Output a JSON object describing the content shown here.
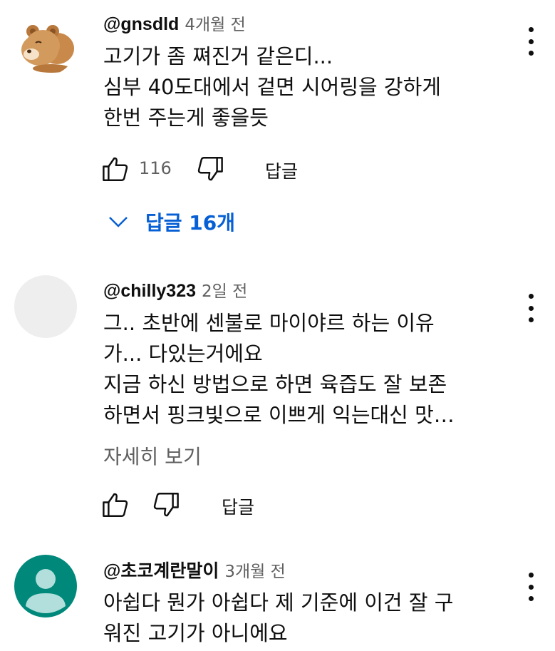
{
  "comments": [
    {
      "handle": "@gnsdld",
      "time": "4개월 전",
      "text_lines": [
        "고기가 좀 쪄진거 같은디...",
        "심부 40도대에서 겉면 시어링을 강하게",
        "한번 주는게 좋을듯"
      ],
      "like_count": "116",
      "reply_label": "답글",
      "replies_toggle": "답글 16개",
      "avatar": "bear-avatar"
    },
    {
      "handle": "@chilly323",
      "time": "2일 전",
      "text_lines": [
        "그.. 초반에 센불로 마이야르 하는 이유",
        "가... 다있는거에요",
        "지금 하신 방법으로 하면 육즙도 잘 보존",
        "하면서 핑크빛으로 이쁘게 익는대신 맛…"
      ],
      "read_more": "자세히 보기",
      "reply_label": "답글",
      "avatar": "blank-avatar"
    },
    {
      "handle": "@초코계란말이",
      "time": "3개월 전",
      "text_lines": [
        "아쉽다 뭔가 아쉽다 제 기준에 이건 잘 구",
        "워진 고기가 아니에요"
      ],
      "avatar": "default-person-avatar"
    }
  ],
  "icons": {
    "like": "thumbs-up-icon",
    "dislike": "thumbs-down-icon",
    "menu": "more-vert-icon",
    "expand": "chevron-down-icon"
  },
  "colors": {
    "link_blue": "#065fd4",
    "secondary_text": "#606060",
    "avatar_teal": "#00897b",
    "avatar_blank": "#eeeeee"
  }
}
